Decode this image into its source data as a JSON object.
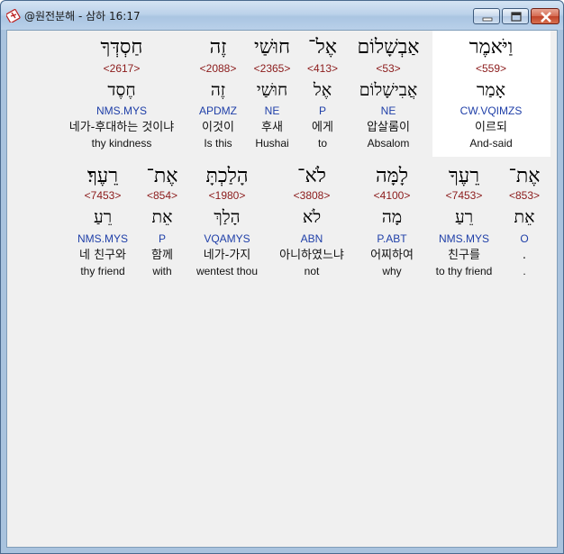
{
  "window": {
    "title": "@원전분해 - 삼하 16:17",
    "icon": "cross-book-icon",
    "controls": {
      "minimize": "minimize-icon",
      "maximize": "maximize-icon",
      "close": "close-icon"
    },
    "accent": "#1f3fa8",
    "strong_color": "#8b1a1a"
  },
  "rows": [
    {
      "words": [
        {
          "hebrew": "וַיֹּאמֶר",
          "strong": "<559>",
          "root": "אָמַר",
          "parse": "CW.VQIMZS",
          "korean": "이르되",
          "english": "And-said",
          "highlighted": true
        },
        {
          "hebrew": "אַבְשָׁלוֹם",
          "strong": "<53>",
          "root": "אֲבִישָׁלוֹם",
          "parse": "NE",
          "korean": "압살롬이",
          "english": "Absalom"
        },
        {
          "hebrew": "אֶל־",
          "strong": "<413>",
          "root": "אֶל",
          "parse": "P",
          "korean": "에게",
          "english": "to"
        },
        {
          "hebrew": "חוּשַׁי",
          "strong": "<2365>",
          "root": "חוּשַׁי",
          "parse": "NE",
          "korean": "후새",
          "english": "Hushai"
        },
        {
          "hebrew": "זֶה",
          "strong": "<2088>",
          "root": "זֶה",
          "parse": "APDMZ",
          "korean": "이것이",
          "english": "Is this"
        },
        {
          "hebrew": "חַסְדְּךָ",
          "strong": "<2617>",
          "root": "חֶסֶד",
          "parse": "NMS.MYS",
          "korean": "네가-후대하는 것이냐",
          "english": "thy kindness"
        }
      ]
    },
    {
      "words": [
        {
          "hebrew": "אֶת־",
          "strong": "<853>",
          "root": "אֵת",
          "parse": "O",
          "korean": ".",
          "english": "."
        },
        {
          "hebrew": "רֵעֶךָ",
          "strong": "<7453>",
          "root": "רֵעַ",
          "parse": "NMS.MYS",
          "korean": "친구를",
          "english": "to thy friend"
        },
        {
          "hebrew": "לָמָּה",
          "strong": "<4100>",
          "root": "מָה",
          "parse": "P.ABT",
          "korean": "어찌하여",
          "english": "why"
        },
        {
          "hebrew": "לֹא־",
          "strong": "<3808>",
          "root": "לֹא",
          "parse": "ABN",
          "korean": "아니하였느냐",
          "english": "not"
        },
        {
          "hebrew": "הָלַכְתָּ",
          "strong": "<1980>",
          "root": "הָלַךְ",
          "parse": "VQAMYS",
          "korean": "네가-가지",
          "english": "wentest thou"
        },
        {
          "hebrew": "אֶת־",
          "strong": "<854>",
          "root": "אֵת",
          "parse": "P",
          "korean": "함께",
          "english": "with"
        },
        {
          "hebrew": "רֵעֶךָ׃",
          "strong": "<7453>",
          "root": "רֵעַ",
          "parse": "NMS.MYS",
          "korean": "네 친구와",
          "english": "thy friend"
        }
      ]
    }
  ]
}
